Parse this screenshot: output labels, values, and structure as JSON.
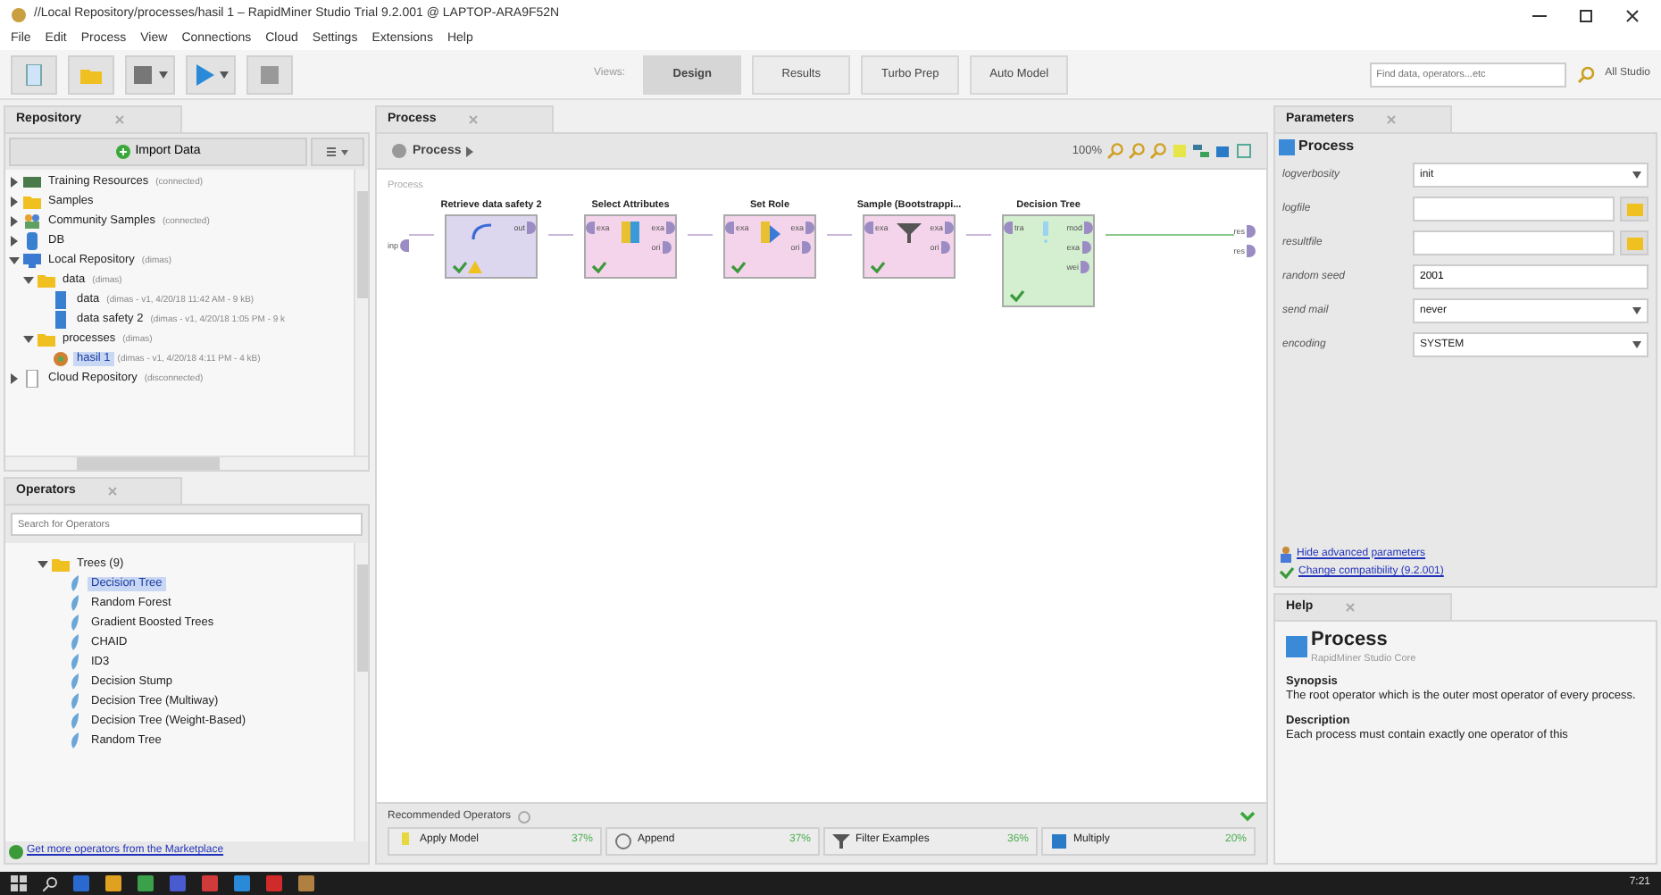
{
  "window": {
    "title": "//Local Repository/processes/hasil 1 – RapidMiner Studio Trial 9.2.001 @ LAPTOP-ARA9F52N"
  },
  "menu": [
    "File",
    "Edit",
    "Process",
    "View",
    "Connections",
    "Cloud",
    "Settings",
    "Extensions",
    "Help"
  ],
  "toolbar": {
    "views_label": "Views:",
    "views": [
      {
        "label": "Design",
        "selected": true
      },
      {
        "label": "Results",
        "selected": false
      },
      {
        "label": "Turbo Prep",
        "selected": false
      },
      {
        "label": "Auto Model",
        "selected": false
      }
    ],
    "search": {
      "placeholder": "Find data, operators...etc"
    },
    "scope": "All Studio"
  },
  "repository": {
    "title": "Repository",
    "import_button": "Import Data",
    "tree": [
      {
        "label": "Training Resources",
        "meta": "(connected)",
        "kind": "training",
        "expanded": false,
        "selected": false
      },
      {
        "label": "Samples",
        "kind": "folder",
        "expanded": false,
        "selected": false
      },
      {
        "label": "Community Samples",
        "meta": "(connected)",
        "kind": "community",
        "expanded": false,
        "selected": false
      },
      {
        "label": "DB",
        "kind": "db",
        "expanded": false,
        "selected": false
      },
      {
        "label": "Local Repository",
        "meta": "(dimas)",
        "kind": "local",
        "expanded": true,
        "selected": false,
        "children": [
          {
            "label": "data",
            "meta": "(dimas)",
            "kind": "folder",
            "expanded": true,
            "selected": false,
            "children": [
              {
                "label": "data",
                "meta": "(dimas - v1, 4/20/18 11:42 AM - 9 kB)",
                "kind": "data",
                "selected": false
              },
              {
                "label": "data safety 2",
                "meta": "(dimas - v1, 4/20/18 1:05 PM - 9 k",
                "kind": "data",
                "selected": false
              }
            ]
          },
          {
            "label": "processes",
            "meta": "(dimas)",
            "kind": "folder",
            "expanded": true,
            "selected": false,
            "children": [
              {
                "label": "hasil 1",
                "meta": "(dimas - v1, 4/20/18 4:11 PM - 4 kB)",
                "kind": "process",
                "selected": true
              }
            ]
          }
        ]
      },
      {
        "label": "Cloud Repository",
        "meta": "(disconnected)",
        "kind": "cloud",
        "expanded": false,
        "selected": false
      }
    ]
  },
  "operators": {
    "title": "Operators",
    "search": {
      "placeholder": "Search for Operators"
    },
    "tree": [
      {
        "label": "Trees (9)",
        "kind": "folder",
        "expanded": true,
        "selected": false,
        "children": [
          {
            "label": "Decision Tree",
            "kind": "operator",
            "selected": true
          },
          {
            "label": "Random Forest",
            "kind": "operator",
            "selected": false
          },
          {
            "label": "Gradient Boosted Trees",
            "kind": "operator",
            "selected": false
          },
          {
            "label": "CHAID",
            "kind": "operator",
            "selected": false
          },
          {
            "label": "ID3",
            "kind": "operator",
            "selected": false
          },
          {
            "label": "Decision Stump",
            "kind": "operator",
            "selected": false
          },
          {
            "label": "Decision Tree (Multiway)",
            "kind": "operator",
            "selected": false
          },
          {
            "label": "Decision Tree (Weight-Based)",
            "kind": "operator",
            "selected": false
          },
          {
            "label": "Random Tree",
            "kind": "operator",
            "selected": false
          }
        ]
      }
    ],
    "marketplace_link": "Get more operators from the Marketplace"
  },
  "process": {
    "tab": "Process",
    "breadcrumb": "Process",
    "zoom": "100%",
    "canvas_label": "Process",
    "input_port": "inp",
    "result_ports": [
      "res",
      "res"
    ],
    "nodes": [
      {
        "title": "Retrieve data safety 2",
        "kind": "retrieve",
        "outputs": [
          "out"
        ],
        "ok": true,
        "warning": true
      },
      {
        "title": "Select Attributes",
        "kind": "select",
        "inputs": [
          "exa"
        ],
        "outputs": [
          "exa",
          "ori"
        ],
        "ok": true,
        "warning": false
      },
      {
        "title": "Set Role",
        "kind": "role",
        "inputs": [
          "exa"
        ],
        "outputs": [
          "exa",
          "ori"
        ],
        "ok": true,
        "warning": false
      },
      {
        "title": "Sample (Bootstrappi...",
        "kind": "sample",
        "inputs": [
          "exa"
        ],
        "outputs": [
          "exa",
          "ori"
        ],
        "ok": true,
        "warning": false
      },
      {
        "title": "Decision Tree",
        "kind": "model",
        "inputs": [
          "tra"
        ],
        "outputs": [
          "mod",
          "exa",
          "wei"
        ],
        "ok": true,
        "warning": false
      }
    ],
    "recommended": {
      "title": "Recommended Operators",
      "items": [
        {
          "label": "Apply Model",
          "kind": "bulb",
          "share": "37%"
        },
        {
          "label": "Append",
          "kind": "append",
          "share": "37%"
        },
        {
          "label": "Filter Examples",
          "kind": "filter",
          "share": "36%"
        },
        {
          "label": "Multiply",
          "kind": "multiply",
          "share": "20%"
        }
      ]
    }
  },
  "parameters": {
    "title": "Parameters",
    "operator": "Process",
    "rows": [
      {
        "label": "logverbosity",
        "kind": "select",
        "value": "init"
      },
      {
        "label": "logfile",
        "kind": "file"
      },
      {
        "label": "resultfile",
        "kind": "file"
      },
      {
        "label": "random seed",
        "kind": "text",
        "value": "2001"
      },
      {
        "label": "send mail",
        "kind": "select",
        "value": "never"
      },
      {
        "label": "encoding",
        "kind": "select",
        "value": "SYSTEM"
      }
    ],
    "links": [
      {
        "label": "Hide advanced parameters",
        "kind": "advanced"
      },
      {
        "label": "Change compatibility (9.2.001)",
        "kind": "check"
      }
    ]
  },
  "help": {
    "title": "Help",
    "operator": "Process",
    "source": "RapidMiner Studio Core",
    "sections": [
      {
        "heading": "Synopsis",
        "text": "The root operator which is the outer most operator of every process."
      },
      {
        "heading": "Description",
        "text": "Each process must contain exactly one operator of this"
      }
    ]
  },
  "taskbar": {
    "clock": "7:21"
  }
}
